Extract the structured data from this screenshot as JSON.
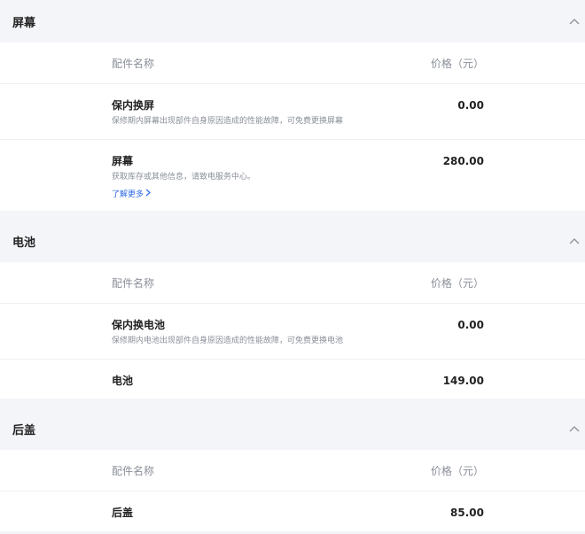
{
  "sections": [
    {
      "title": "屏幕",
      "col_name": "配件名称",
      "col_price": "价格（元）",
      "rows": [
        {
          "name": "保内换屏",
          "desc": "保修期内屏幕出现部件自身原因造成的性能故障，可免费更换屏幕",
          "price": "0.00"
        },
        {
          "name": "屏幕",
          "desc": "获取库存或其他信息，请致电服务中心。",
          "link": "了解更多",
          "price": "280.00"
        }
      ]
    },
    {
      "title": "电池",
      "col_name": "配件名称",
      "col_price": "价格（元）",
      "rows": [
        {
          "name": "保内换电池",
          "desc": "保修期内电池出现部件自身原因造成的性能故障，可免费更换电池",
          "price": "0.00"
        },
        {
          "name": "电池",
          "price": "149.00"
        }
      ]
    },
    {
      "title": "后盖",
      "col_name": "配件名称",
      "col_price": "价格（元）",
      "rows": [
        {
          "name": "后盖",
          "price": "85.00"
        }
      ]
    }
  ],
  "icons": {
    "collapse": "chevron-up-icon",
    "link_arrow": "chevron-right-icon"
  },
  "colors": {
    "page_bg": "#f4f5f9",
    "card_bg": "#ffffff",
    "link": "#2e6be6",
    "muted": "#8a8f99"
  }
}
